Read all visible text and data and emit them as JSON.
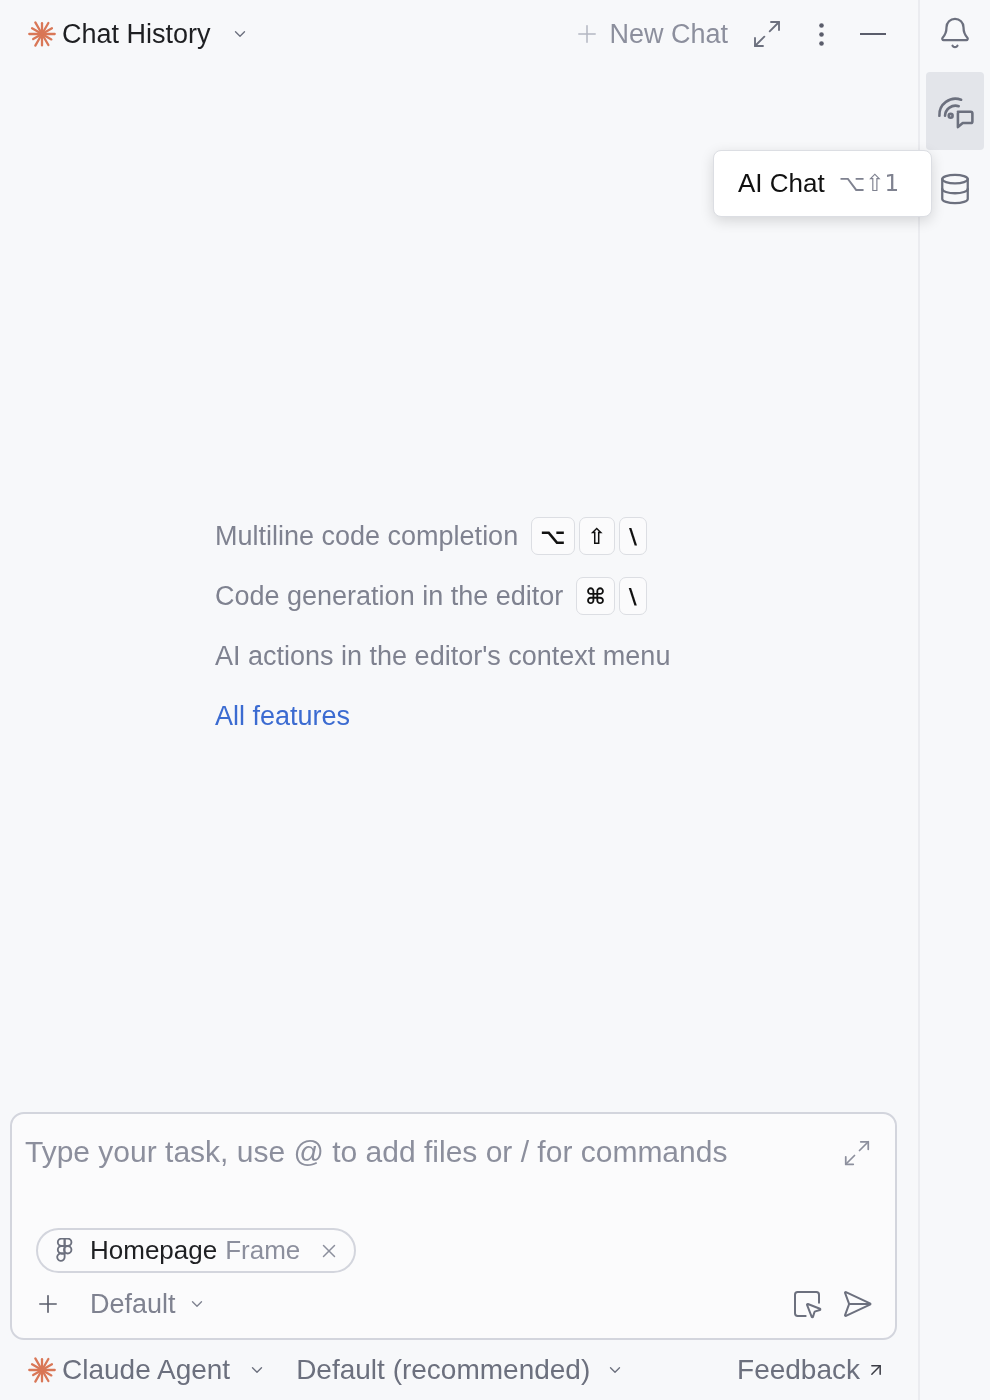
{
  "header": {
    "title": "Chat History",
    "new_chat": {
      "label": "New Chat",
      "disabled": true
    }
  },
  "sidebar": {
    "items": [
      {
        "selected": false
      },
      {
        "selected": true
      },
      {
        "selected": false
      }
    ]
  },
  "tooltip": {
    "label": "AI Chat",
    "shortcut": "⌥⇧1"
  },
  "tips": [
    {
      "text": "Multiline code completion",
      "keys": [
        "⌥",
        "⇧",
        "\\"
      ]
    },
    {
      "text": "Code generation in the editor",
      "keys": [
        "⌘",
        "\\"
      ]
    },
    {
      "text": "AI actions in the editor's context menu"
    }
  ],
  "link": "All features",
  "composer": {
    "placeholder": "Type your task, use @ to add files or / for commands",
    "attachment": {
      "name": "Homepage",
      "type": "Frame"
    },
    "mode": "Default"
  },
  "footer": {
    "agent": "Claude Agent",
    "model": "Default (recommended)",
    "feedback": "Feedback"
  }
}
